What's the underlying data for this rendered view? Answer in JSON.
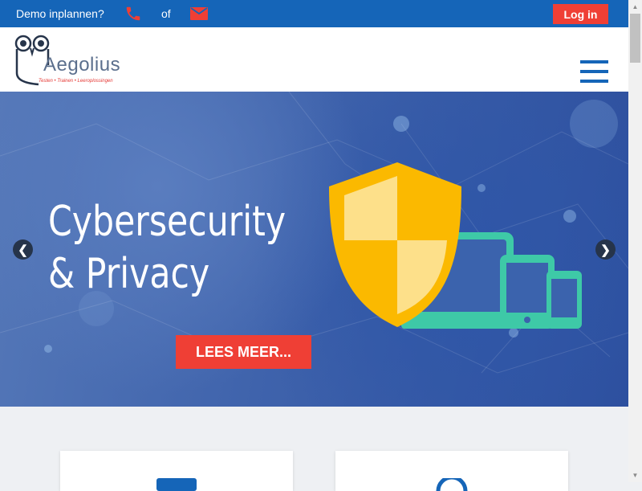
{
  "topbar": {
    "demo_text": "Demo inplannen?",
    "phone_icon": "phone-icon",
    "or_text": "of",
    "mail_icon": "mail-icon",
    "login_label": "Log in",
    "bg_color": "#1565b8",
    "accent_color": "#ef3f35"
  },
  "header": {
    "logo_name": "Aegolius",
    "logo_tagline": "Testen • Trainen • Leeroplossingen",
    "menu_icon": "hamburger-menu-icon"
  },
  "hero": {
    "title_line1": "Cybersecurity",
    "title_line2": "& Privacy",
    "cta_label": "LEES MEER...",
    "prev_icon": "chevron-left-icon",
    "next_icon": "chevron-right-icon",
    "prev_glyph": "❮",
    "next_glyph": "❯"
  },
  "features": {
    "card_icons": [
      "laptop-icon",
      "globe-icon"
    ]
  },
  "scrollbar": {
    "up_glyph": "▲",
    "down_glyph": "▼"
  }
}
